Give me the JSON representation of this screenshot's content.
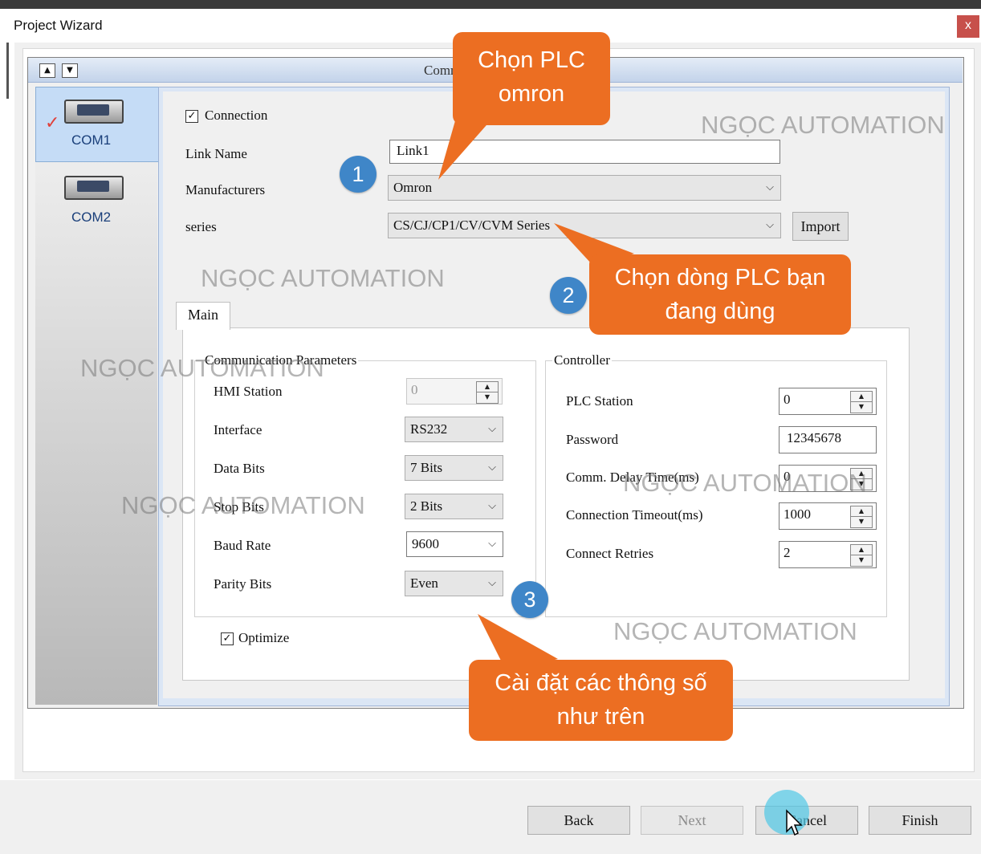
{
  "window": {
    "title": "Project Wizard",
    "close_glyph": "x"
  },
  "header": {
    "title": "Comm",
    "up_glyph": "▲",
    "down_glyph": "▼"
  },
  "ports": [
    {
      "label": "COM1",
      "selected": true,
      "checkmark": "✓"
    },
    {
      "label": "COM2",
      "selected": false
    }
  ],
  "connection": {
    "checkbox_label": "Connection",
    "checked": true,
    "link_name_label": "Link Name",
    "link_name_value": "Link1",
    "manufacturers_label": "Manufacturers",
    "manufacturers_value": "Omron",
    "series_label": "series",
    "series_value": "CS/CJ/CP1/CV/CVM Series",
    "import_label": "Import"
  },
  "tabs": [
    {
      "label": "Main",
      "active": true
    }
  ],
  "comm_params": {
    "title": "Communication Parameters",
    "hmi_station": {
      "label": "HMI Station",
      "value": "0"
    },
    "interface": {
      "label": "Interface",
      "value": "RS232"
    },
    "data_bits": {
      "label": "Data Bits",
      "value": "7 Bits"
    },
    "stop_bits": {
      "label": "Stop Bits",
      "value": "2 Bits"
    },
    "baud_rate": {
      "label": "Baud Rate",
      "value": "9600"
    },
    "parity_bits": {
      "label": "Parity Bits",
      "value": "Even"
    }
  },
  "controller": {
    "title": "Controller",
    "plc_station": {
      "label": "PLC Station",
      "value": "0"
    },
    "password": {
      "label": "Password",
      "value": "12345678"
    },
    "comm_delay": {
      "label": "Comm. Delay Time(ms)",
      "value": "0"
    },
    "conn_timeout": {
      "label": "Connection Timeout(ms)",
      "value": "1000"
    },
    "connect_retries": {
      "label": "Connect Retries",
      "value": "2"
    }
  },
  "optimize": {
    "label": "Optimize",
    "checked": true
  },
  "buttons": {
    "back": "Back",
    "next": "Next",
    "cancel": "Cancel",
    "finish": "Finish"
  },
  "annotations": {
    "callout1": "Chọn PLC omron",
    "callout2": "Chọn dòng PLC bạn đang dùng",
    "callout3": "Cài đặt các thông số như trên",
    "num1": "1",
    "num2": "2",
    "num3": "3",
    "watermark": "NGỌC AUTOMATION"
  },
  "colors": {
    "callout": "#ec6e22",
    "step_badge": "#3f86c8",
    "selected_tab": "#c5dcf6"
  },
  "glyphs": {
    "check": "✓",
    "dropdown": "⌵",
    "spin_up": "▲",
    "spin_down": "▼"
  }
}
